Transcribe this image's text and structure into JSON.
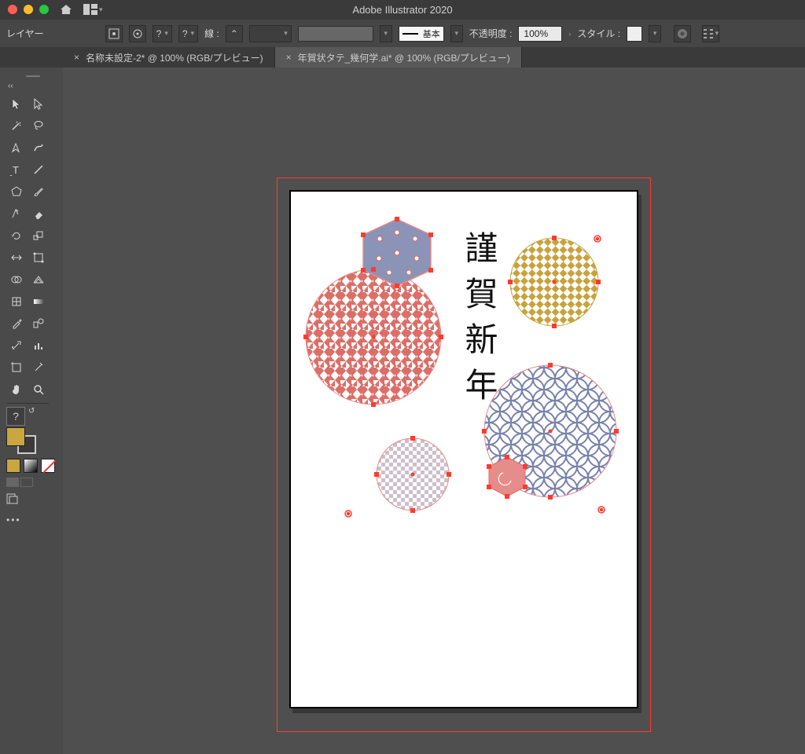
{
  "app": {
    "title": "Adobe Illustrator 2020"
  },
  "panel_label": "レイヤー",
  "control": {
    "stroke_label": "線 :",
    "stroke_style": "基本",
    "opacity_label": "不透明度 :",
    "opacity_value": "100%",
    "style_label": "スタイル :"
  },
  "tabs": [
    {
      "label": "名称未設定-2* @ 100% (RGB/プレビュー)",
      "active": false
    },
    {
      "label": "年賀状タテ_幾何学.ai* @ 100% (RGB/プレビュー)",
      "active": true
    }
  ],
  "artwork": {
    "greeting": "謹賀新年"
  },
  "colors": {
    "sel": "#ff3b30",
    "red_pat": "#dc6e68",
    "blue_pat": "#7982ab",
    "gold_pat": "#c8a23c",
    "pink": "#e68c8a"
  }
}
